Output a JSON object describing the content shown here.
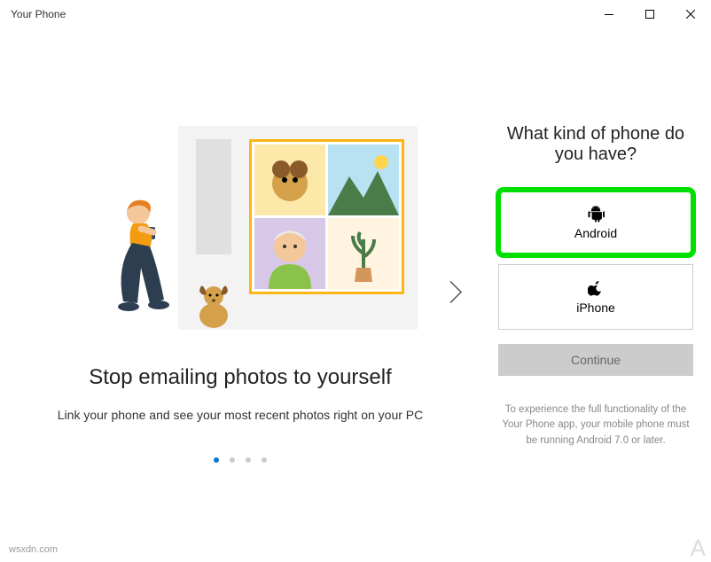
{
  "window": {
    "title": "Your Phone"
  },
  "left": {
    "heading": "Stop emailing photos to yourself",
    "subheading": "Link your phone and see your most recent photos right on your PC",
    "active_dot": 0,
    "dot_count": 4
  },
  "right": {
    "question": "What kind of phone do you have?",
    "options": [
      {
        "label": "Android",
        "icon": "android-icon",
        "highlighted": true
      },
      {
        "label": "iPhone",
        "icon": "apple-icon",
        "highlighted": false
      }
    ],
    "continue_label": "Continue",
    "disclaimer": "To experience the full functionality of the Your Phone app, your mobile phone must be running Android 7.0 or later."
  },
  "watermarks": {
    "bl": "wsxdn.com",
    "br": "A"
  }
}
